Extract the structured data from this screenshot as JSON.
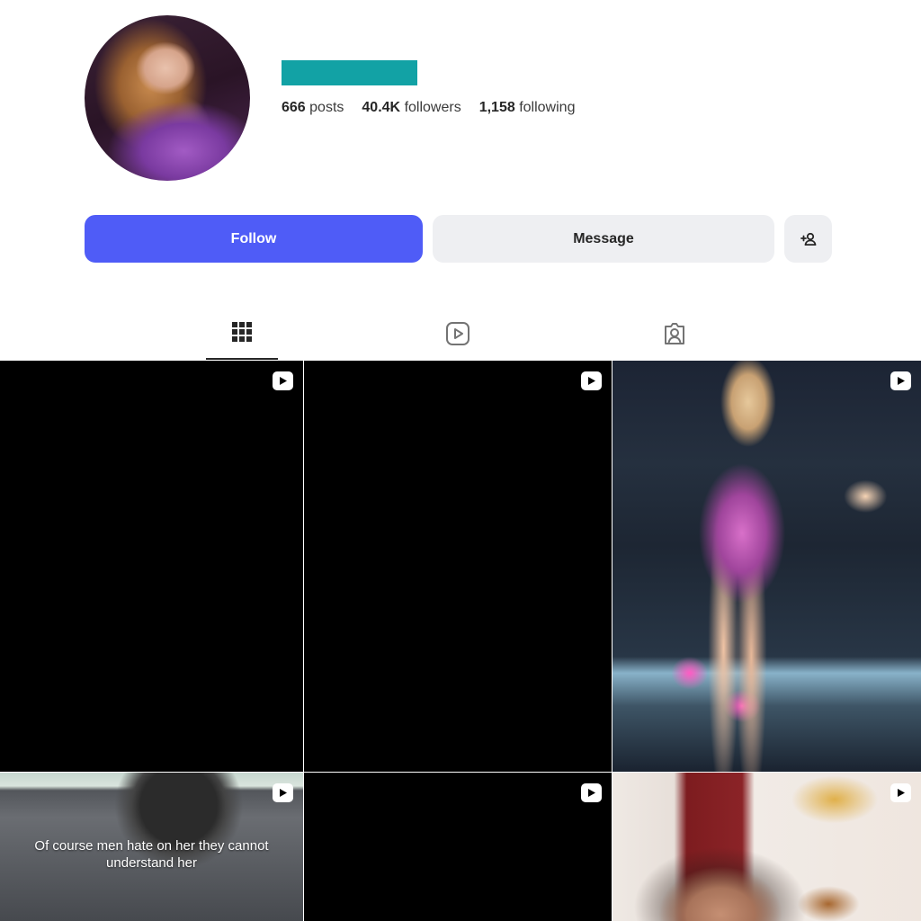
{
  "profile": {
    "posts_count": "666",
    "posts_label": "posts",
    "followers_count": "40.4K",
    "followers_label": "followers",
    "following_count": "1,158",
    "following_label": "following",
    "username_redaction_color": "#12a2a5"
  },
  "actions": {
    "follow_label": "Follow",
    "message_label": "Message",
    "add_user_icon": "add-user-icon"
  },
  "tabs": [
    {
      "name": "posts-grid",
      "icon": "grid-icon",
      "active": true
    },
    {
      "name": "reels",
      "icon": "reels-icon",
      "active": false
    },
    {
      "name": "tagged",
      "icon": "tagged-user-icon",
      "active": false
    }
  ],
  "grid": {
    "items": [
      {
        "type": "reel",
        "thumbnail": "black"
      },
      {
        "type": "reel",
        "thumbnail": "black"
      },
      {
        "type": "reel",
        "thumbnail": "concert-performer-on-stage"
      },
      {
        "type": "reel",
        "thumbnail": "car-dashboard",
        "caption": "Of course men hate on her they cannot understand her"
      },
      {
        "type": "reel",
        "thumbnail": "black"
      },
      {
        "type": "reel",
        "thumbnail": "woman-with-phone"
      }
    ]
  },
  "colors": {
    "follow_button": "#4f5cf7",
    "secondary_button": "#eeeff2",
    "text": "#262626"
  }
}
